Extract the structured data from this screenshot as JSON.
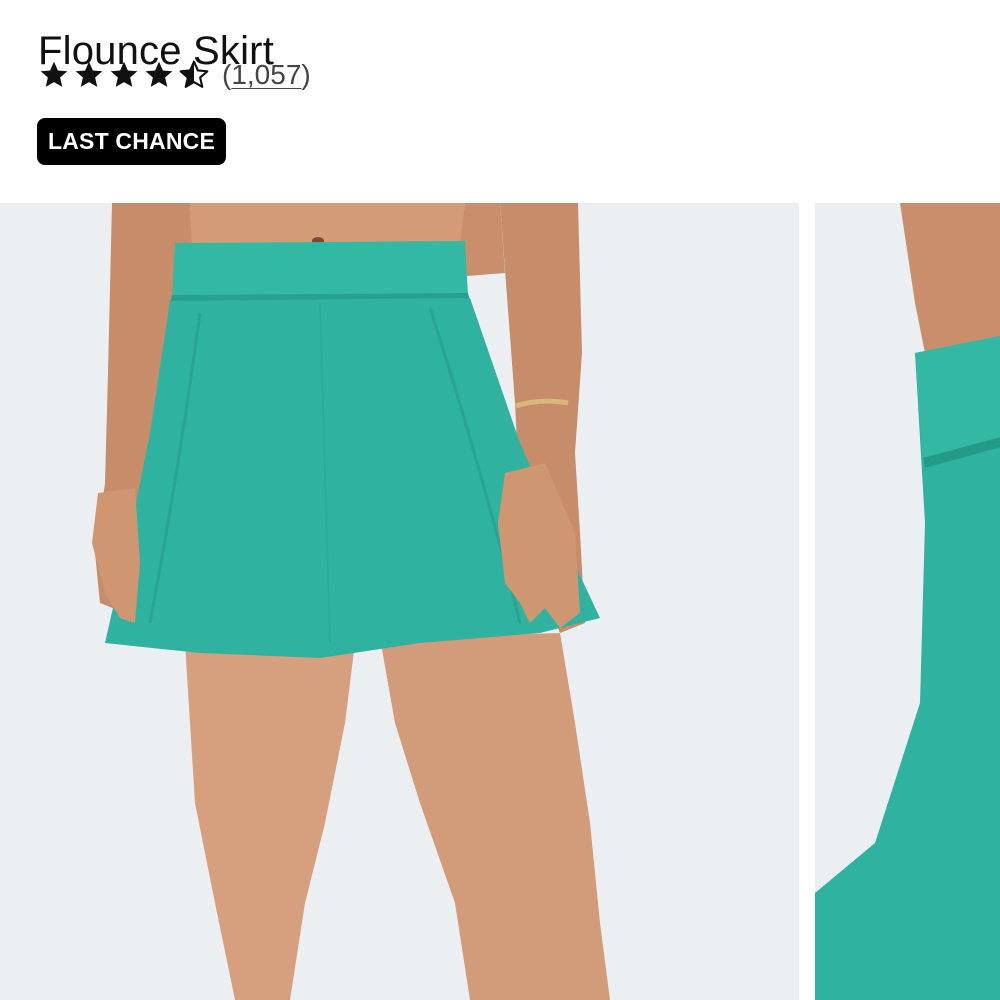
{
  "product": {
    "title": "Flounce Skirt",
    "rating": {
      "value": 4.5,
      "max": 5,
      "count_open": "(",
      "count": "1,057",
      "count_close": ")"
    },
    "badge": "LAST CHANCE"
  },
  "gallery": {
    "images": [
      {
        "subject": "model wearing teal flounce skirt, front view"
      },
      {
        "subject": "model wearing teal flounce skirt, side view (partial)"
      }
    ]
  },
  "colors": {
    "skirt": "#2fb3a0",
    "skin": "#d29a78",
    "background": "#eceff1",
    "badge_bg": "#000000",
    "badge_text": "#ffffff"
  },
  "icons": {
    "star_full": "star-full-icon",
    "star_half": "star-half-icon"
  }
}
